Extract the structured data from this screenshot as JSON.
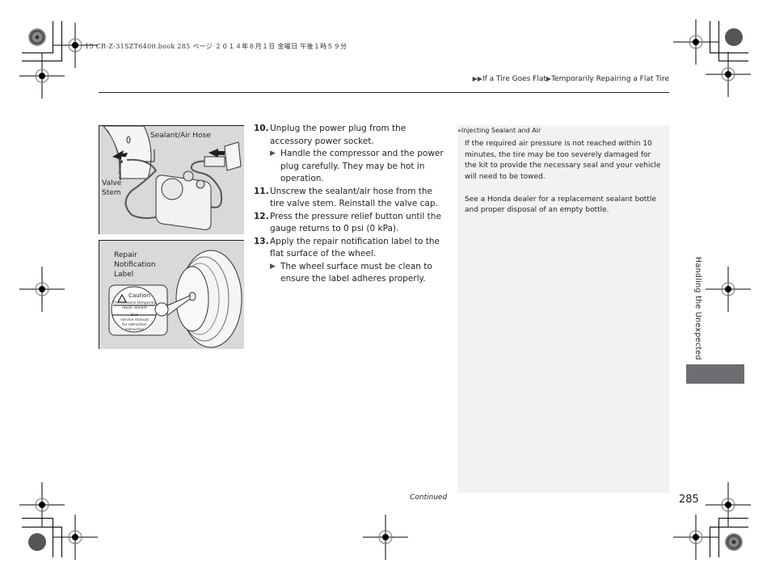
{
  "print_header": "15 CR-Z-31SZT6400.book  285 ページ  ２０１４年８月１日  金曜日  午後１時５９分",
  "breadcrumb": {
    "marker": "▶▶",
    "items": [
      "If a Tire Goes Flat",
      "Temporarily Repairing a Flat Tire"
    ],
    "separator": "▶"
  },
  "figures": {
    "compressor": {
      "labels": {
        "hose": "Sealant/Air Hose",
        "valve_line1": "Valve",
        "valve_line2": "Stem"
      }
    },
    "label": {
      "labels": {
        "line1": "Repair",
        "line2": "Notification",
        "line3": "Label"
      },
      "sticker": {
        "caution": "Caution",
        "line1": "Tire contains temporary",
        "line2": "repair sealant",
        "line3": "See",
        "line4": "service manual",
        "line5": "for extraction",
        "line6": "instruction"
      }
    }
  },
  "steps": [
    {
      "num": "10.",
      "text": "Unplug the power plug from the accessory power socket.",
      "note": "Handle the compressor and the power plug carefully. They may be hot in operation."
    },
    {
      "num": "11.",
      "text": "Unscrew the sealant/air hose from the tire valve stem. Reinstall the valve cap.",
      "note": null
    },
    {
      "num": "12.",
      "text": "Press the pressure relief button until the gauge returns to 0 psi (0 kPa).",
      "note": null
    },
    {
      "num": "13.",
      "text": "Apply the repair notification label to the flat surface of the wheel.",
      "note": "The wheel surface must be clean to ensure the label adheres properly."
    }
  ],
  "note_marker": "▶",
  "sidebar": {
    "icon": "»",
    "title": "Injecting Sealant and Air",
    "paragraphs": [
      "If the required air pressure is not reached within 10 minutes, the tire may be too severely damaged for the kit to provide the necessary seal and your vehicle will need to be towed.",
      "See a Honda dealer for a replacement sealant bottle and proper disposal of an empty bottle."
    ]
  },
  "section_tab": "Handling the Unexpected",
  "footer": {
    "continued": "Continued",
    "page_number": "285"
  },
  "colors": {
    "sidebar_bg": "#f2f2f2",
    "figure_bg": "#d9d9d9",
    "tab_block": "#6d6e71",
    "text": "#231f20"
  }
}
